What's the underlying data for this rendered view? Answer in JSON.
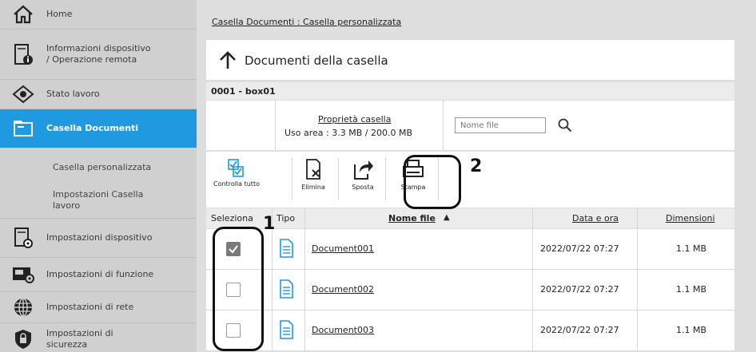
{
  "sidebar": {
    "items": [
      {
        "label": "Home",
        "icon": "home-icon"
      },
      {
        "label": "Informazioni dispositivo / Operazione remota",
        "line1": "Informazioni dispositivo",
        "line2": "/ Operazione remota",
        "icon": "device-info-icon"
      },
      {
        "label": "Stato lavoro",
        "icon": "eye-icon"
      },
      {
        "label": "Casella Documenti",
        "icon": "folder-icon",
        "active": true
      },
      {
        "label": "Casella personalizzata",
        "sub": true
      },
      {
        "label": "Impostazioni Casella lavoro",
        "line1": "Impostazioni Casella",
        "line2": "lavoro",
        "sub": true
      },
      {
        "label": "Impostazioni dispositivo",
        "icon": "device-settings-icon"
      },
      {
        "label": "Impostazioni di funzione",
        "icon": "function-settings-icon"
      },
      {
        "label": "Impostazioni di rete",
        "icon": "globe-icon"
      },
      {
        "label": "Impostazioni di sicurezza",
        "line1": "Impostazioni di",
        "line2": "sicurezza",
        "icon": "shield-icon"
      }
    ],
    "active_color": "#1f9ae0"
  },
  "main": {
    "breadcrumb": "Casella Documenti : Casella personalizzata",
    "panel_title": "Documenti della casella",
    "box_id": "0001 - box01",
    "box_props_link": "Proprietà casella",
    "usage": "Uso area : 3.3 MB / 200.0 MB",
    "search_placeholder": "Nome file",
    "toolbar": {
      "check_all": "Controlla tutto",
      "delete": "Elimina",
      "move": "Sposta",
      "print": "Stampa"
    },
    "columns": {
      "select": "Seleziona",
      "type": "Tipo",
      "filename": "Nome file",
      "sort_indicator": "▲",
      "date": "Data e ora",
      "size": "Dimensioni"
    },
    "rows": [
      {
        "name": "Document001",
        "date": "2022/07/22 07:27",
        "size": "1.1 MB",
        "checked": true
      },
      {
        "name": "Document002",
        "date": "2022/07/22 07:27",
        "size": "1.1 MB",
        "checked": false
      },
      {
        "name": "Document003",
        "date": "2022/07/22 07:27",
        "size": "1.1 MB",
        "checked": false
      }
    ]
  },
  "callouts": {
    "one": "1",
    "two": "2"
  }
}
